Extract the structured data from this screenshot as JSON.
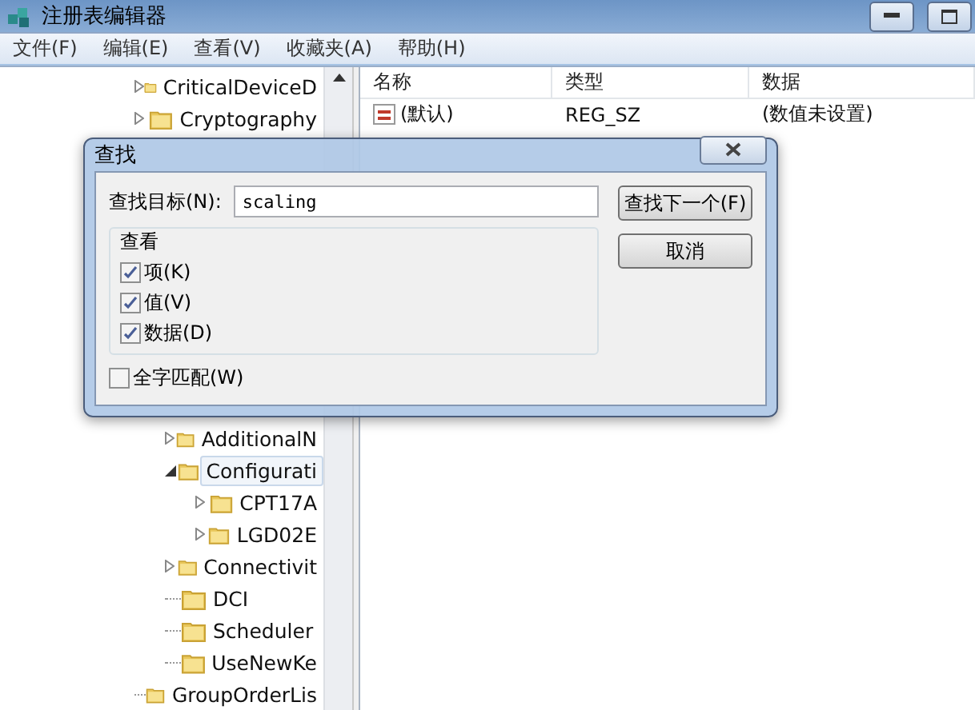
{
  "window": {
    "title": "注册表编辑器"
  },
  "menu": [
    {
      "label": "文件(F)"
    },
    {
      "label": "编辑(E)"
    },
    {
      "label": "查看(V)"
    },
    {
      "label": "收藏夹(A)"
    },
    {
      "label": "帮助(H)"
    }
  ],
  "tree": [
    {
      "label": "CriticalDeviceD",
      "kind": "collapsed",
      "selected": false
    },
    {
      "label": "Cryptography",
      "kind": "collapsed",
      "selected": false
    },
    {
      "children": [
        {
          "label": "AdditionalN",
          "kind": "collapsed",
          "selected": false
        },
        {
          "label": "Configurati",
          "kind": "expanded",
          "selected": true,
          "children": [
            {
              "label": "CPT17A",
              "kind": "collapsed",
              "selected": false
            },
            {
              "label": "LGD02E",
              "kind": "collapsed",
              "selected": false
            }
          ]
        },
        {
          "label": "Connectivit",
          "kind": "collapsed",
          "selected": false
        },
        {
          "label": "DCI",
          "kind": "leaf",
          "selected": false
        },
        {
          "label": "Scheduler",
          "kind": "leaf",
          "selected": false
        },
        {
          "label": "UseNewKe",
          "kind": "leaf",
          "selected": false
        }
      ]
    },
    {
      "label": "GroupOrderLis",
      "kind": "leaf",
      "selected": false
    }
  ],
  "table": {
    "columns": [
      "名称",
      "类型",
      "数据"
    ],
    "rows": [
      {
        "name": "(默认)",
        "type": "REG_SZ",
        "data": "(数值未设置)"
      }
    ]
  },
  "dialog": {
    "title": "查找",
    "find_label": "查找目标(N):",
    "find_value": "scaling",
    "find_next_button": "查找下一个(F)",
    "cancel_button": "取消",
    "group_title": "查看",
    "options": [
      {
        "label": "项(K)",
        "checked": true
      },
      {
        "label": "值(V)",
        "checked": true
      },
      {
        "label": "数据(D)",
        "checked": true
      }
    ],
    "match_whole": {
      "label": "全字匹配(W)",
      "checked": false
    }
  }
}
